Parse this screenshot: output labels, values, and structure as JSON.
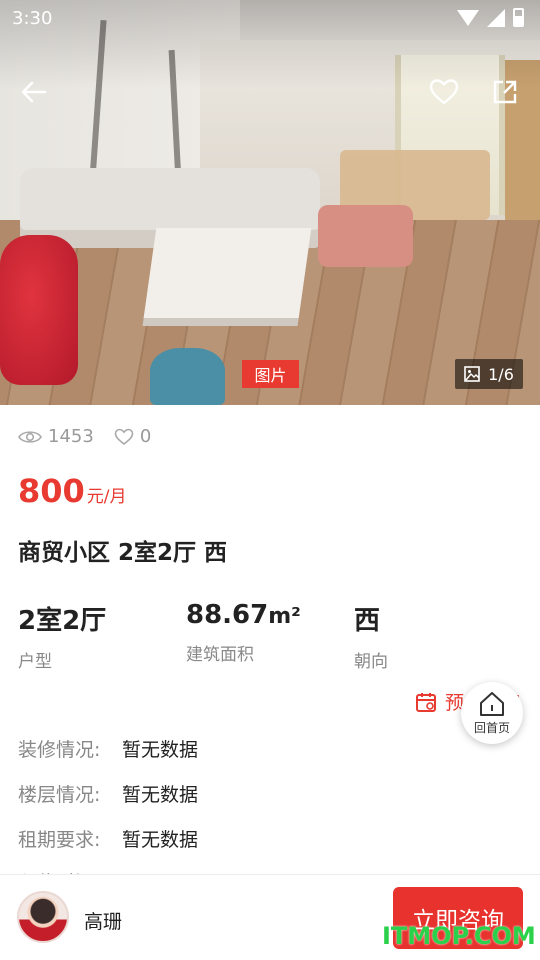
{
  "status_bar": {
    "time": "3:30"
  },
  "photo": {
    "tag": "图片",
    "counter": "1/6"
  },
  "stats": {
    "views": "1453",
    "favorites": "0"
  },
  "price": {
    "amount": "800",
    "unit": "元/月"
  },
  "title": "商贸小区 2室2厅 西",
  "specs": [
    {
      "value": "2室2厅",
      "label": "户型"
    },
    {
      "value": "88.67",
      "unit": "m²",
      "label": "建筑面积"
    },
    {
      "value": "西",
      "label": "朝向"
    }
  ],
  "booking": {
    "label": "预约看房"
  },
  "home_fab": {
    "label": "回首页"
  },
  "details": [
    {
      "key": "装修情况:",
      "value": "暂无数据"
    },
    {
      "key": "楼层情况:",
      "value": "暂无数据"
    },
    {
      "key": "租期要求:",
      "value": "暂无数据"
    }
  ],
  "details_more": "入住时间",
  "agent": {
    "name": "高珊"
  },
  "consult_button": "立即咨询",
  "watermark": "ITMOP.COM",
  "colors": {
    "accent": "#e83a30",
    "watermark": "#2bd14a"
  }
}
